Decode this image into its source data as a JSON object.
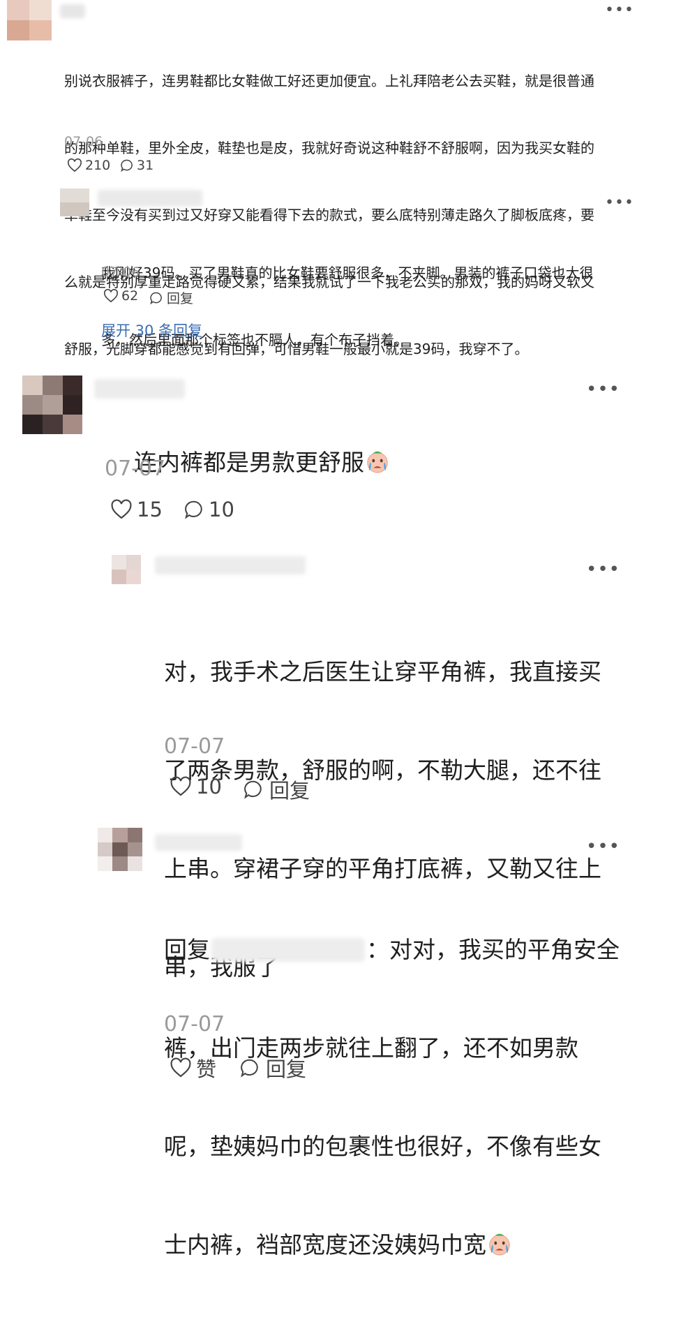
{
  "comments": [
    {
      "id": "c1",
      "text": "别说衣服裤子，连男鞋都比女鞋做工好还更加便宜。上礼拜陪老公去买鞋，就是很普通的那种单鞋，里外全皮，鞋垫也是皮，我就好奇说这种鞋舒不舒服啊，因为我买女鞋的单鞋至今没有买到过又好穿又能看得下去的款式，要么底特别薄走路久了脚板底疼，要么就是特别厚重走路觉得硬又累，结果我就试了一下我老公买的那双，我的妈呀又软又舒服，光脚穿都能感觉到有回弹，可惜男鞋一般最小就是39码，我穿不了。",
      "lines": [
        "别说衣服裤子，连男鞋都比女鞋做工好还更加便宜。上礼拜陪老公去买鞋，就是很普通",
        "的那种单鞋，里外全皮，鞋垫也是皮，我就好奇说这种鞋舒不舒服啊，因为我买女鞋的",
        "单鞋至今没有买到过又好穿又能看得下去的款式，要么底特别薄走路久了脚板底疼，要",
        "么就是特别厚重走路觉得硬又累，结果我就试了一下我老公买的那双，我的妈呀又软又",
        "舒服，光脚穿都能感觉到有回弹，可惜男鞋一般最小就是39码，我穿不了。"
      ],
      "date": "07-06",
      "likes": "210",
      "replies": "31"
    },
    {
      "id": "c1r1",
      "lines": [
        "我刚好39码。买了男鞋真的比女鞋要舒服很多，不夹脚。男装的裤子口袋也大很",
        "多，然后里面那个标签也不膈人，有个布子挡着。"
      ],
      "date": "07-06",
      "likes": "62",
      "reply_label": "回复"
    },
    {
      "id": "expand",
      "label": "展开 30 条回复"
    },
    {
      "id": "c2",
      "text": "连内裤都是男款更舒服",
      "date": "07-07",
      "likes": "15",
      "replies": "10"
    },
    {
      "id": "c2r1",
      "lines": [
        "对，我手术之后医生让穿平角裤，我直接买",
        "了两条男款，舒服的啊，不勒大腿，还不往",
        "上串。穿裙子穿的平角打底裤，又勒又往上",
        "串，我服了"
      ],
      "date": "07-07",
      "likes": "10",
      "reply_label": "回复"
    },
    {
      "id": "c2r2",
      "reply_prefix": "回复",
      "after_name": "：对对，我买的平角安全",
      "lines": [
        "裤，出门走两步就往上翻了，还不如男款",
        "呢，垫姨妈巾的包裹性也很好，不像有些女",
        "士内裤，裆部宽度还没姨妈巾宽"
      ],
      "date": "07-07",
      "like_label": "赞",
      "reply_label": "回复"
    }
  ],
  "colors": {
    "link": "#3b6db4",
    "date": "#9a9a9a",
    "text": "#1f1f1f"
  },
  "icons": [
    "heart-outline-icon",
    "comment-bubble-icon",
    "more-dots-icon",
    "crying-emoji-icon"
  ]
}
